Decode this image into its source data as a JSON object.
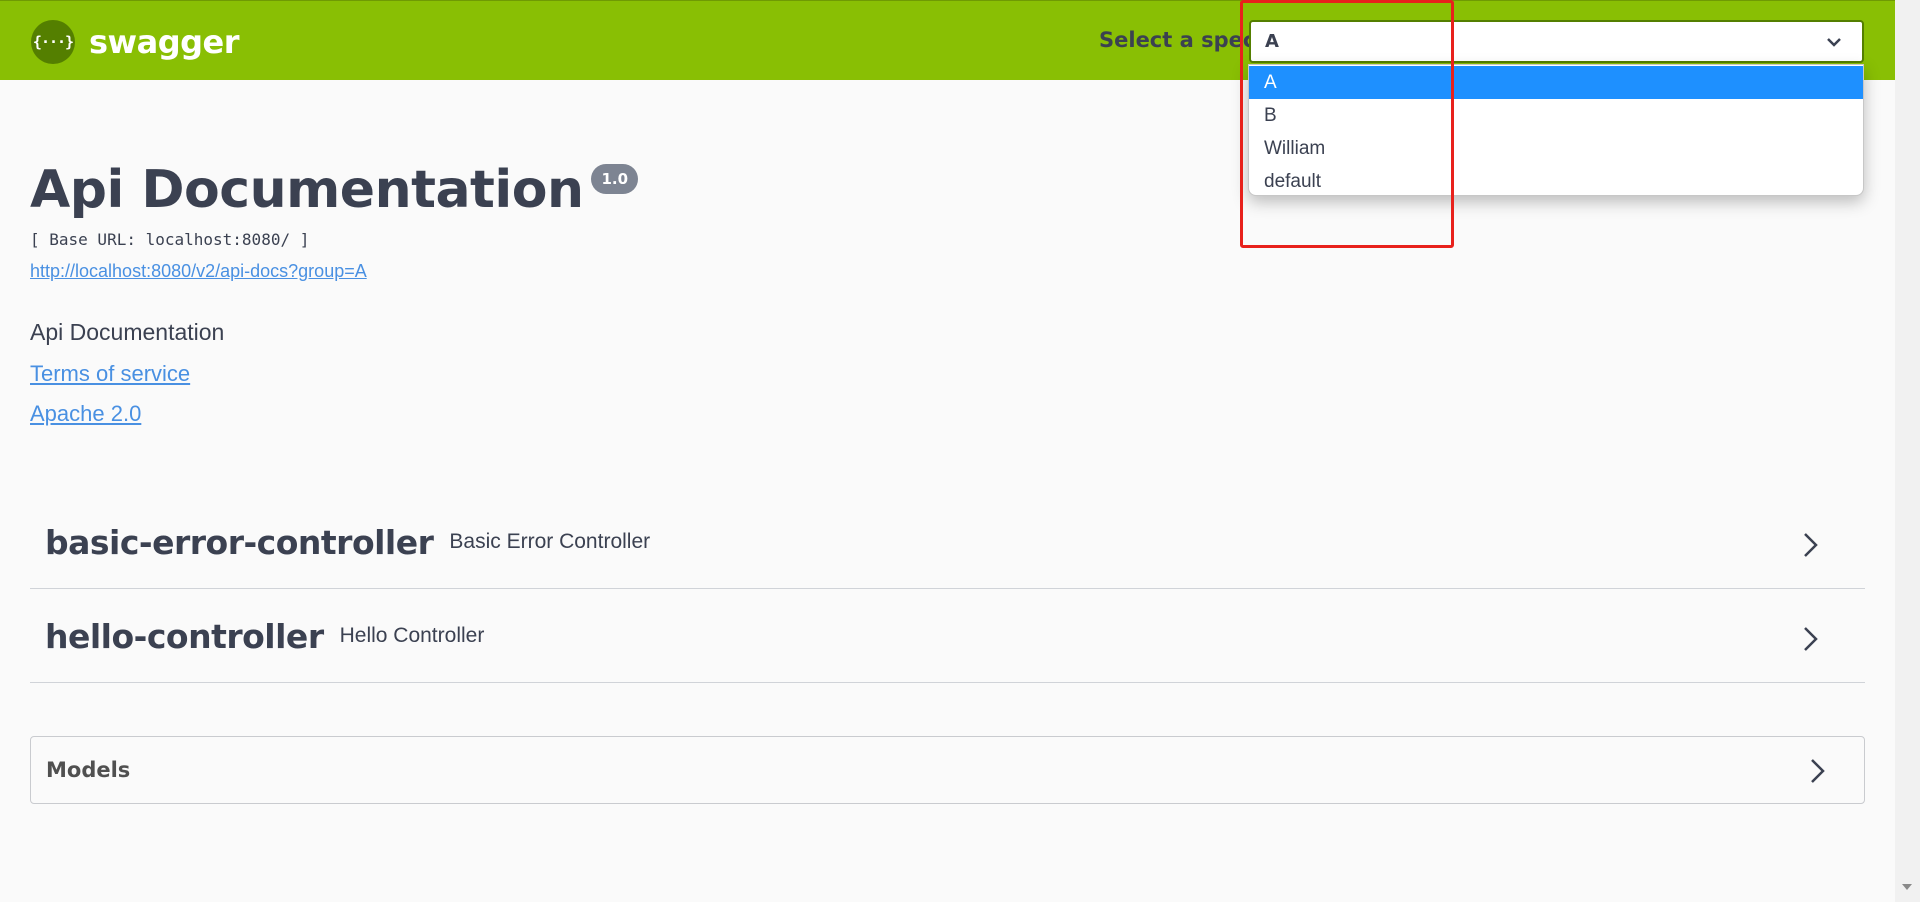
{
  "topbar": {
    "logo_glyph": "{···}",
    "logo_text": "swagger",
    "spec_label": "Select a spec",
    "spec_selected": "A",
    "spec_options": [
      "A",
      "B",
      "William",
      "default"
    ]
  },
  "info": {
    "title": "Api Documentation",
    "version": "1.0",
    "base_url": "[ Base URL: localhost:8080/ ]",
    "api_docs_link": "http://localhost:8080/v2/api-docs?group=A",
    "description": "Api Documentation",
    "terms_link": "Terms of service",
    "license_link": "Apache 2.0"
  },
  "tags": [
    {
      "name": "basic-error-controller",
      "description": "Basic Error Controller"
    },
    {
      "name": "hello-controller",
      "description": "Hello Controller"
    }
  ],
  "models": {
    "label": "Models"
  },
  "colors": {
    "topbar": "#89bf04",
    "selected_option": "#1e90ff",
    "link": "#4990e2",
    "highlight": "#e8211c"
  }
}
